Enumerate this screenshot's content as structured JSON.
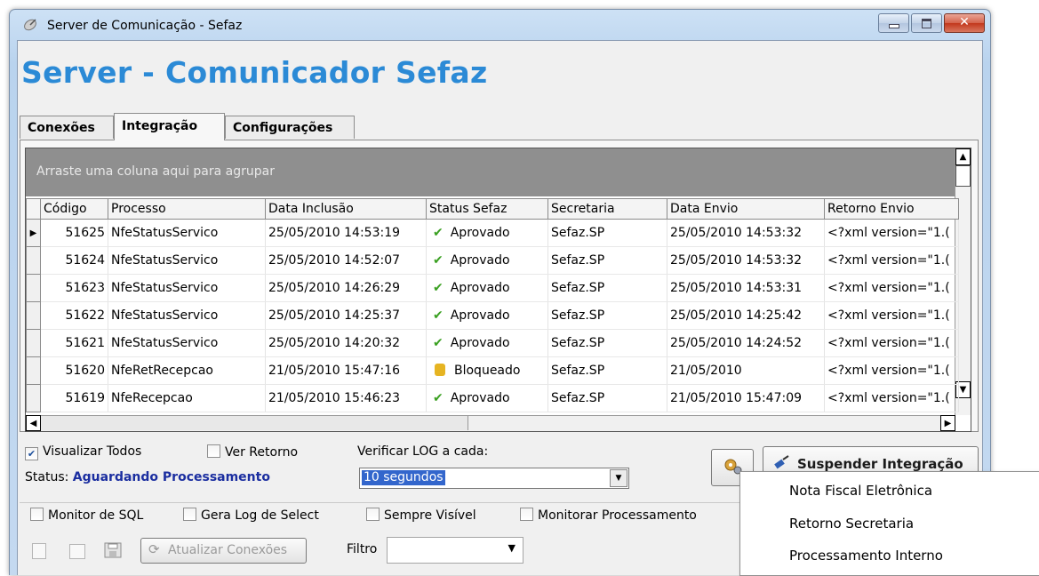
{
  "window": {
    "title": "Server de Comunicação - Sefaz"
  },
  "banner": "Server - Comunicador Sefaz",
  "tabs": [
    {
      "label": "Conexões"
    },
    {
      "label": "Integração"
    },
    {
      "label": "Configurações"
    }
  ],
  "grid": {
    "group_hint": "Arraste uma coluna aqui para agrupar",
    "columns": [
      "Código",
      "Processo",
      "Data Inclusão",
      "Status Sefaz",
      "Secretaria",
      "Data Envio",
      "Retorno Envio"
    ],
    "rows": [
      {
        "codigo": "51625",
        "processo": "NfeStatusServico",
        "data_inclusao": "25/05/2010 14:53:19",
        "status": "Aprovado",
        "status_icon": "check-icon",
        "secretaria": "Sefaz.SP",
        "data_envio": "25/05/2010 14:53:32",
        "retorno": "<?xml version=\"1.("
      },
      {
        "codigo": "51624",
        "processo": "NfeStatusServico",
        "data_inclusao": "25/05/2010 14:52:07",
        "status": "Aprovado",
        "status_icon": "check-icon",
        "secretaria": "Sefaz.SP",
        "data_envio": "25/05/2010 14:53:32",
        "retorno": "<?xml version=\"1.("
      },
      {
        "codigo": "51623",
        "processo": "NfeStatusServico",
        "data_inclusao": "25/05/2010 14:26:29",
        "status": "Aprovado",
        "status_icon": "check-icon",
        "secretaria": "Sefaz.SP",
        "data_envio": "25/05/2010 14:53:31",
        "retorno": "<?xml version=\"1.("
      },
      {
        "codigo": "51622",
        "processo": "NfeStatusServico",
        "data_inclusao": "25/05/2010 14:25:37",
        "status": "Aprovado",
        "status_icon": "check-icon",
        "secretaria": "Sefaz.SP",
        "data_envio": "25/05/2010 14:25:42",
        "retorno": "<?xml version=\"1.("
      },
      {
        "codigo": "51621",
        "processo": "NfeStatusServico",
        "data_inclusao": "25/05/2010 14:20:32",
        "status": "Aprovado",
        "status_icon": "check-icon",
        "secretaria": "Sefaz.SP",
        "data_envio": "25/05/2010 14:24:52",
        "retorno": "<?xml version=\"1.("
      },
      {
        "codigo": "51620",
        "processo": "NfeRetRecepcao",
        "data_inclusao": "21/05/2010 15:47:16",
        "status": "Bloqueado",
        "status_icon": "lock-icon",
        "secretaria": "Sefaz.SP",
        "data_envio": "21/05/2010",
        "retorno": "<?xml version=\"1.("
      },
      {
        "codigo": "51619",
        "processo": "NfeRecepcao",
        "data_inclusao": "21/05/2010 15:46:23",
        "status": "Aprovado",
        "status_icon": "check-icon",
        "secretaria": "Sefaz.SP",
        "data_envio": "21/05/2010 15:47:09",
        "retorno": "<?xml version=\"1.("
      }
    ]
  },
  "options": {
    "visualizar_todos": {
      "label": "Visualizar Todos",
      "checked": true
    },
    "ver_retorno": {
      "label": "Ver Retorno",
      "checked": false
    },
    "verificar_log_label": "Verificar LOG a cada:",
    "verificar_log_value": "10 segundos",
    "status_label": "Status:",
    "status_value": "Aguardando Processamento",
    "suspender_label": "Suspender Integração"
  },
  "bottom": {
    "monitor_sql": "Monitor de SQL",
    "gera_log": "Gera Log de Select",
    "sempre_visivel": "Sempre Visível",
    "monitorar_proc": "Monitorar Processamento",
    "atualizar": "Atualizar Conexões",
    "filtro_label": "Filtro",
    "filtro_value": ""
  },
  "context_menu": [
    "Nota Fiscal Eletrônica",
    "Retorno Secretaria",
    "Processamento Interno"
  ],
  "colors": {
    "banner": "#2b8ad6",
    "status_value": "#1b2ea0",
    "approved": "#3aa021"
  }
}
